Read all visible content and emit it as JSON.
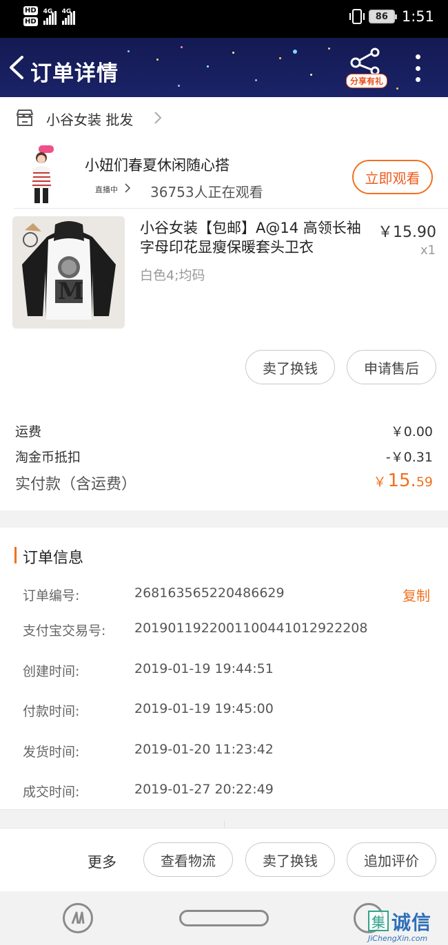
{
  "status_bar": {
    "hd1": "HD",
    "hd2": "HD",
    "net1": "4G",
    "net2": "4G",
    "battery": "86",
    "time": "1:51"
  },
  "nav": {
    "title": "订单详情",
    "share_badge": "分享有礼"
  },
  "shop": {
    "name": "小谷女装 批发"
  },
  "live": {
    "title": "小妞们春夏休闲随心搭",
    "status": "直播中",
    "viewers": "36753人正在观看",
    "watch_button": "立即观看"
  },
  "product": {
    "title": "小谷女装【包邮】A@14 高领长袖字母印花显瘦保暖套头卫衣",
    "price": "￥15.90",
    "quantity": "x1",
    "sku": "白色4;均码",
    "sell_button": "卖了换钱",
    "aftersale_button": "申请售后"
  },
  "summary": {
    "shipping_label": "运费",
    "shipping_value": "￥0.00",
    "coin_label": "淘金币抵扣",
    "coin_value": "-￥0.31",
    "paid_label": "实付款（含运费）",
    "paid_currency": "￥",
    "paid_int": "15.",
    "paid_dec": "59"
  },
  "order_info": {
    "title": "订单信息",
    "copy": "复制",
    "rows": [
      {
        "label": "订单编号:",
        "value": "268163565220486629"
      },
      {
        "label": "支付宝交易号:",
        "value": "2019011922001100441012922208"
      },
      {
        "label": "创建时间:",
        "value": "2019-01-19 19:44:51"
      },
      {
        "label": "付款时间:",
        "value": "2019-01-19 19:45:00"
      },
      {
        "label": "发货时间:",
        "value": "2019-01-20 11:23:42"
      },
      {
        "label": "成交时间:",
        "value": "2019-01-27 20:22:49"
      }
    ]
  },
  "actions": {
    "more": "更多",
    "logistics": "查看物流",
    "sell": "卖了换钱",
    "review": "追加评价"
  },
  "watermark": {
    "box": "集",
    "text": "诚信",
    "url": "JiChengXin.com"
  },
  "colors": {
    "accent": "#f0701e",
    "nav_bg": "#141a52"
  }
}
